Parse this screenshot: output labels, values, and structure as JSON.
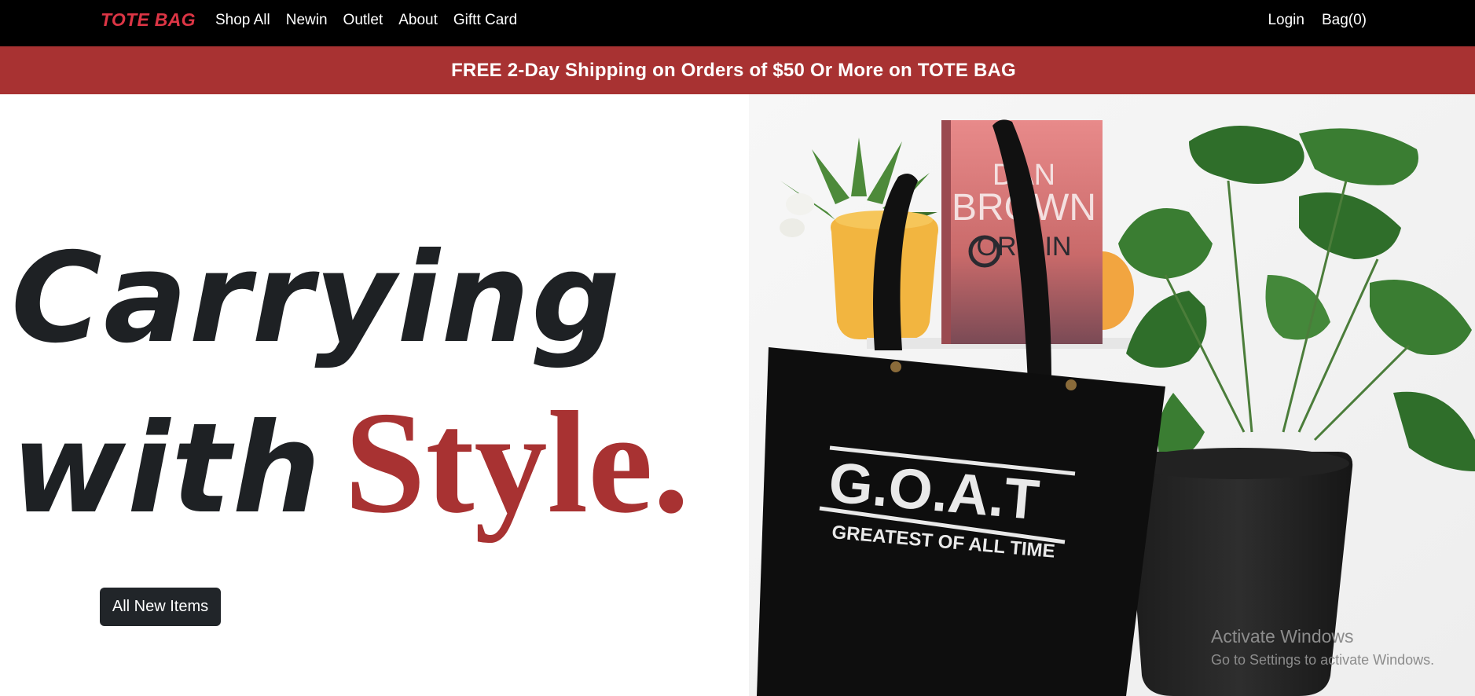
{
  "nav": {
    "brand": "TOTE BAG",
    "links": [
      "Shop All",
      "Newin",
      "Outlet",
      "About",
      "Giftt Card"
    ],
    "login": "Login",
    "bag": "Bag(0)"
  },
  "promo": {
    "text": "FREE 2-Day Shipping on Orders of $50 Or More on TOTE BAG"
  },
  "hero": {
    "line1": "Carrying",
    "line2_word": "with",
    "line2_accent": "Style.",
    "cta_label": "All New Items"
  },
  "product_image": {
    "book_author_top": "DAN",
    "book_author_bottom": "BROWN",
    "book_title": "ORIGIN",
    "bag_title": "G.O.A.T",
    "bag_subtitle": "GREATEST OF ALL TIME"
  },
  "watermark": {
    "title": "Activate Windows",
    "subtitle": "Go to Settings to activate Windows."
  },
  "colors": {
    "accent": "#a83232",
    "brand": "#dc3545",
    "nav_bg": "#000000",
    "text_dark": "#1e2124"
  }
}
